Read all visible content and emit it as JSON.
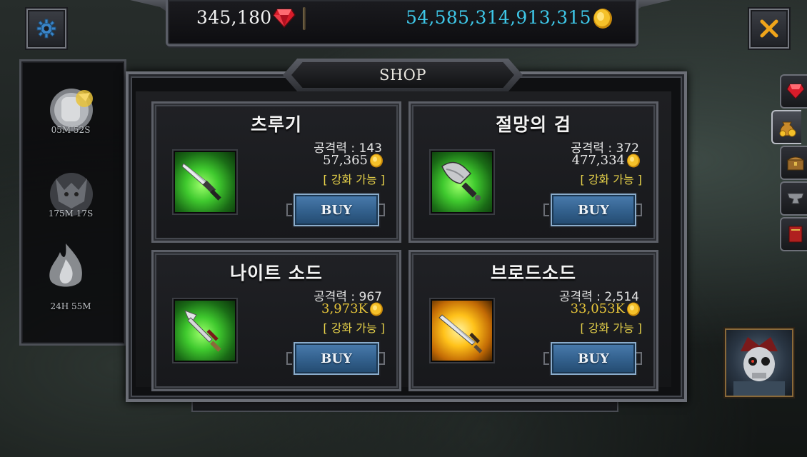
{
  "currency": {
    "gems": "345,180",
    "gold": "54,585,314,913,315",
    "gold_color": "#3ec7e8",
    "gem_icon": "red-gem-icon",
    "gold_icon": "gold-coin-icon"
  },
  "timers": [
    {
      "label": "05M 52S",
      "icon": "fist-coin-icon"
    },
    {
      "label": "175M 17S",
      "icon": "demon-emblem-icon"
    },
    {
      "label": "24H 55M",
      "icon": "flame-spirit-icon"
    }
  ],
  "shop": {
    "title": "SHOP",
    "buy_label": "BUY",
    "items": [
      {
        "name": "츠루기",
        "stat": "공격력 : 143",
        "price": "57,365",
        "price_color": "#e8e8e8",
        "upgrade": "[ 강화 가능 ]",
        "icon": "dagger-icon"
      },
      {
        "name": "절망의 검",
        "stat": "공격력 : 372",
        "price": "477,334",
        "price_color": "#e8e8e8",
        "upgrade": "[ 강화 가능 ]",
        "icon": "cleaver-blade-icon"
      },
      {
        "name": "나이트 소드",
        "stat": "공격력 : 967",
        "price": "3,973K",
        "price_color": "#e6c53a",
        "upgrade": "[ 강화 가능 ]",
        "icon": "knight-sword-icon"
      },
      {
        "name": "브로드소드",
        "stat": "공격력 : 2,514",
        "price": "33,053K",
        "price_color": "#e6c53a",
        "upgrade": "[ 강화 가능 ]",
        "icon": "broadsword-icon"
      }
    ]
  },
  "side_tabs": [
    "gem-tab-icon",
    "gold-bag-tab-icon",
    "chest-tab-icon",
    "anvil-tab-icon",
    "book-tab-icon"
  ],
  "accent_colors": {
    "upgrade_yellow": "#e6d14a",
    "buy_blue": "#34628f"
  }
}
